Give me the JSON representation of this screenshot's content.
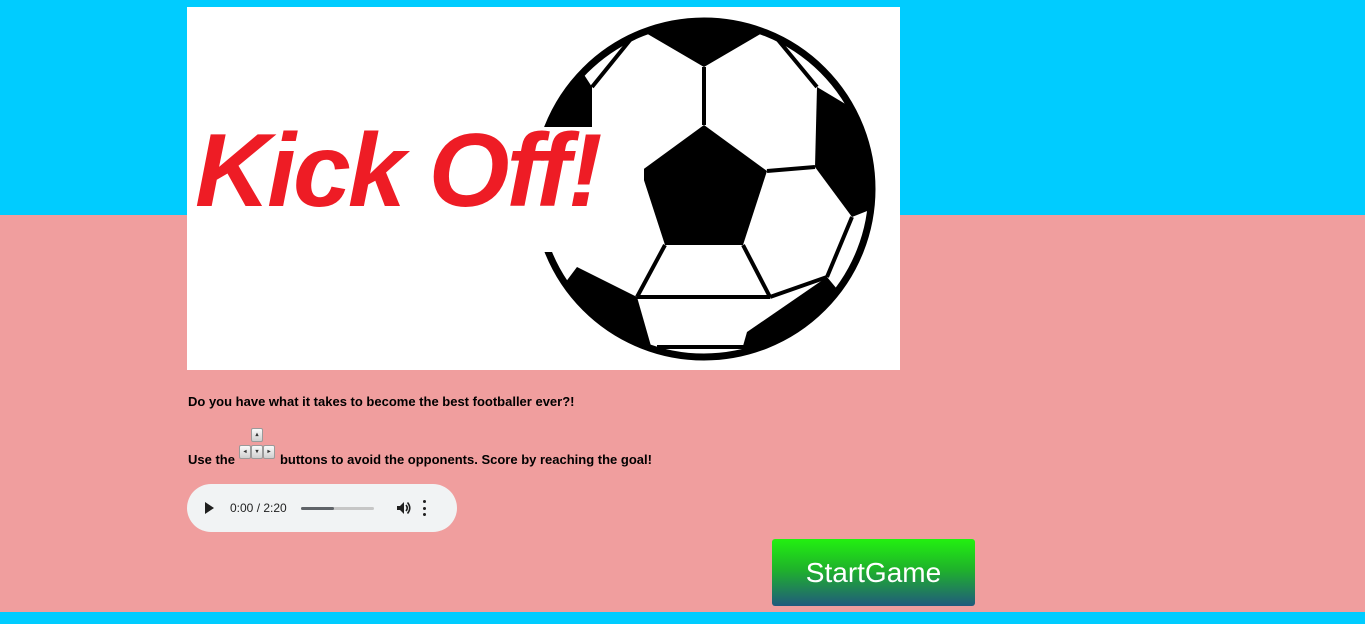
{
  "banner": {
    "title": "Kick Off!",
    "title_color": "#ee1c25",
    "image": "soccer-ball"
  },
  "intro_text": "Do you have what it takes to become the best footballer ever?!",
  "instructions": {
    "before": "Use the",
    "keys_icon": "arrow-keys-icon",
    "after": "buttons to avoid the opponents. Score by reaching the goal!"
  },
  "audio": {
    "time": "0:00 / 2:20",
    "progress_fraction": 0.45
  },
  "start_button": {
    "label": "StartGame"
  },
  "colors": {
    "sky": "#00ccff",
    "background": "#f09e9e",
    "button_top": "#22f010",
    "button_bottom": "#205a7d"
  }
}
